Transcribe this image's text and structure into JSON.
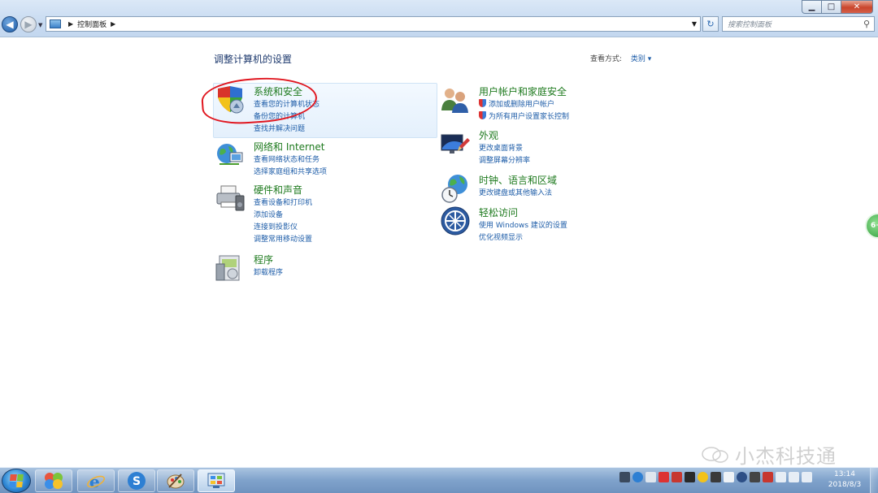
{
  "window": {
    "breadcrumb": [
      "控制面板"
    ],
    "search_placeholder": "搜索控制面板",
    "minimize": "▁",
    "maximize": "□",
    "close": "✕"
  },
  "header": {
    "title": "调整计算机的设置",
    "view_by_label": "查看方式:",
    "view_by_value": "类别 ▾"
  },
  "categories": {
    "system_security": {
      "title": "系统和安全",
      "links": [
        "查看您的计算机状态",
        "备份您的计算机",
        "查找并解决问题"
      ]
    },
    "network": {
      "title": "网络和 Internet",
      "links": [
        "查看网络状态和任务",
        "选择家庭组和共享选项"
      ]
    },
    "hardware": {
      "title": "硬件和声音",
      "links": [
        "查看设备和打印机",
        "添加设备",
        "连接到投影仪",
        "调整常用移动设置"
      ]
    },
    "programs": {
      "title": "程序",
      "links": [
        "卸载程序"
      ]
    },
    "user_accounts": {
      "title": "用户帐户和家庭安全",
      "links": [
        "添加或删除用户帐户",
        "为所有用户设置家长控制"
      ]
    },
    "appearance": {
      "title": "外观",
      "links": [
        "更改桌面背景",
        "调整屏幕分辨率"
      ]
    },
    "clock_region": {
      "title": "时钟、语言和区域",
      "links": [
        "更改键盘或其他输入法"
      ]
    },
    "ease_access": {
      "title": "轻松访问",
      "links": [
        "使用 Windows 建议的设置",
        "优化视频显示"
      ]
    }
  },
  "taskbar": {
    "clock_time": "13:14",
    "clock_date": "2018/8/3"
  },
  "watermark": "小杰科技通",
  "side_bubble": "6+"
}
